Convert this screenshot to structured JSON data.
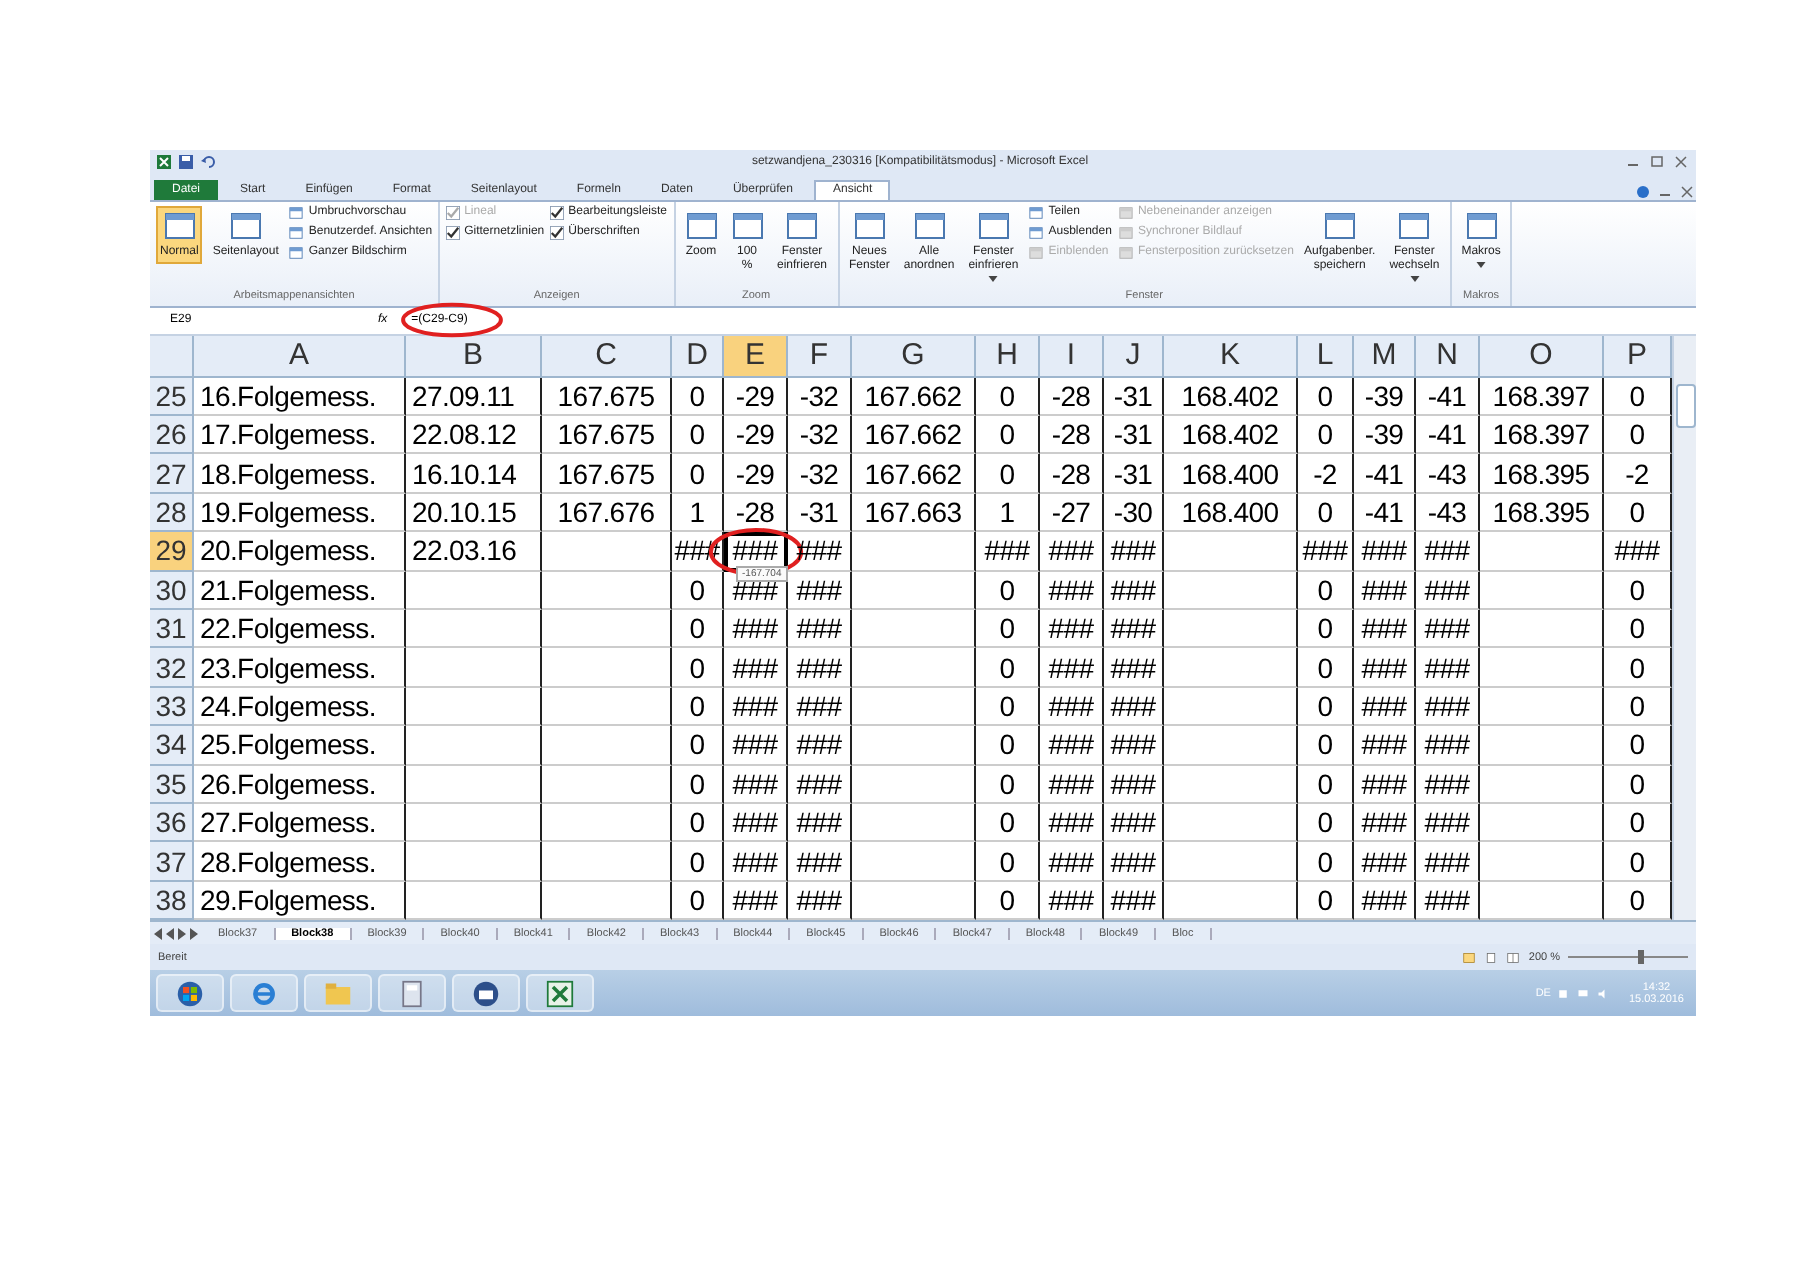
{
  "window": {
    "title": "setzwandjena_230316 [Kompatibilitätsmodus] - Microsoft Excel"
  },
  "tabs": [
    {
      "label": "Datei",
      "selected": false,
      "kind": "file"
    },
    {
      "label": "Start",
      "selected": false,
      "kind": "tab"
    },
    {
      "label": "Einfügen",
      "selected": false,
      "kind": "tab"
    },
    {
      "label": "Format",
      "selected": false,
      "kind": "tab"
    },
    {
      "label": "Seitenlayout",
      "selected": false,
      "kind": "tab"
    },
    {
      "label": "Formeln",
      "selected": false,
      "kind": "tab"
    },
    {
      "label": "Daten",
      "selected": false,
      "kind": "tab"
    },
    {
      "label": "Überprüfen",
      "selected": false,
      "kind": "tab"
    },
    {
      "label": "Ansicht",
      "selected": true,
      "kind": "tab"
    }
  ],
  "ribbon": [
    {
      "title": "Arbeitsmappenansichten",
      "items": [
        {
          "kind": "large",
          "label": "Normal",
          "selected": true
        },
        {
          "kind": "large",
          "label": "Seitenlayout",
          "selected": false
        },
        {
          "kind": "small",
          "label": "Umbruchvorschau",
          "disabled": false
        },
        {
          "kind": "small",
          "label": "Benutzerdef. Ansichten",
          "disabled": false
        },
        {
          "kind": "small",
          "label": "Ganzer Bildschirm",
          "disabled": false
        }
      ]
    },
    {
      "title": "Anzeigen",
      "items": [
        {
          "kind": "check",
          "label": "Lineal",
          "checked": true,
          "disabled": true
        },
        {
          "kind": "check",
          "label": "Gitternetzlinien",
          "checked": true,
          "disabled": false
        },
        {
          "kind": "check",
          "label": "Bearbeitungsleiste",
          "checked": true,
          "disabled": false
        },
        {
          "kind": "check",
          "label": "Überschriften",
          "checked": true,
          "disabled": false
        }
      ]
    },
    {
      "title": "Zoom",
      "items": [
        {
          "kind": "large",
          "label": "Zoom",
          "selected": false
        },
        {
          "kind": "large",
          "label": "100 %",
          "selected": false
        },
        {
          "kind": "large",
          "label": "Fenster einfrieren",
          "selected": false
        }
      ]
    },
    {
      "title": "Fenster",
      "items": [
        {
          "kind": "large",
          "label": "Neues Fenster",
          "selected": false
        },
        {
          "kind": "large",
          "label": "Alle anordnen",
          "selected": false
        },
        {
          "kind": "large",
          "label": "Fenster einfrieren",
          "selected": false,
          "dropdown": true
        },
        {
          "kind": "small",
          "label": "Teilen",
          "disabled": false
        },
        {
          "kind": "small",
          "label": "Ausblenden",
          "disabled": false
        },
        {
          "kind": "small",
          "label": "Einblenden",
          "disabled": true
        },
        {
          "kind": "small",
          "label": "Nebeneinander anzeigen",
          "disabled": true
        },
        {
          "kind": "small",
          "label": "Synchroner Bildlauf",
          "disabled": true
        },
        {
          "kind": "small",
          "label": "Fensterposition zurücksetzen",
          "disabled": true
        },
        {
          "kind": "large",
          "label": "Aufgabenber. speichern",
          "selected": false
        },
        {
          "kind": "large",
          "label": "Fenster wechseln",
          "selected": false,
          "dropdown": true
        }
      ]
    },
    {
      "title": "Makros",
      "items": [
        {
          "kind": "large",
          "label": "Makros",
          "selected": false,
          "dropdown": true
        }
      ]
    }
  ],
  "formula_bar": {
    "name_box": "E29",
    "fx": "fx",
    "formula": "=(C29-C9)",
    "circled": true
  },
  "table": {
    "columns": [
      {
        "label": "A",
        "selected": false
      },
      {
        "label": "B",
        "selected": false
      },
      {
        "label": "C",
        "selected": false
      },
      {
        "label": "D",
        "selected": false
      },
      {
        "label": "E",
        "selected": true
      },
      {
        "label": "F",
        "selected": false
      },
      {
        "label": "G",
        "selected": false
      },
      {
        "label": "H",
        "selected": false
      },
      {
        "label": "I",
        "selected": false
      },
      {
        "label": "J",
        "selected": false
      },
      {
        "label": "K",
        "selected": false
      },
      {
        "label": "L",
        "selected": false
      },
      {
        "label": "M",
        "selected": false
      },
      {
        "label": "N",
        "selected": false
      },
      {
        "label": "O",
        "selected": false
      },
      {
        "label": "P",
        "selected": false
      }
    ],
    "selected_cell": {
      "circled": true,
      "tooltip": "-167.704"
    },
    "rows": [
      {
        "header": "25",
        "selected": false,
        "cells": [
          "16.Folgemess.",
          "27.09.11",
          "167.675",
          "0",
          "-29",
          "-32",
          "167.662",
          "0",
          "-28",
          "-31",
          "168.402",
          "0",
          "-39",
          "-41",
          "168.397",
          "0"
        ]
      },
      {
        "header": "26",
        "selected": false,
        "cells": [
          "17.Folgemess.",
          "22.08.12",
          "167.675",
          "0",
          "-29",
          "-32",
          "167.662",
          "0",
          "-28",
          "-31",
          "168.402",
          "0",
          "-39",
          "-41",
          "168.397",
          "0"
        ]
      },
      {
        "header": "27",
        "selected": false,
        "cells": [
          "18.Folgemess.",
          "16.10.14",
          "167.675",
          "0",
          "-29",
          "-32",
          "167.662",
          "0",
          "-28",
          "-31",
          "168.400",
          "-2",
          "-41",
          "-43",
          "168.395",
          "-2"
        ]
      },
      {
        "header": "28",
        "selected": false,
        "cells": [
          "19.Folgemess.",
          "20.10.15",
          "167.676",
          "1",
          "-28",
          "-31",
          "167.663",
          "1",
          "-27",
          "-30",
          "168.400",
          "0",
          "-41",
          "-43",
          "168.395",
          "0"
        ]
      },
      {
        "header": "29",
        "selected": true,
        "cells": [
          "20.Folgemess.",
          "22.03.16",
          null,
          "###",
          "###",
          "###",
          null,
          "###",
          "###",
          "###",
          null,
          "###",
          "###",
          "###",
          null,
          "###"
        ]
      },
      {
        "header": "30",
        "selected": false,
        "cells": [
          "21.Folgemess.",
          null,
          null,
          "0",
          "###",
          "###",
          null,
          "0",
          "###",
          "###",
          null,
          "0",
          "###",
          "###",
          null,
          "0"
        ]
      },
      {
        "header": "31",
        "selected": false,
        "cells": [
          "22.Folgemess.",
          null,
          null,
          "0",
          "###",
          "###",
          null,
          "0",
          "###",
          "###",
          null,
          "0",
          "###",
          "###",
          null,
          "0"
        ]
      },
      {
        "header": "32",
        "selected": false,
        "cells": [
          "23.Folgemess.",
          null,
          null,
          "0",
          "###",
          "###",
          null,
          "0",
          "###",
          "###",
          null,
          "0",
          "###",
          "###",
          null,
          "0"
        ]
      },
      {
        "header": "33",
        "selected": false,
        "cells": [
          "24.Folgemess.",
          null,
          null,
          "0",
          "###",
          "###",
          null,
          "0",
          "###",
          "###",
          null,
          "0",
          "###",
          "###",
          null,
          "0"
        ]
      },
      {
        "header": "34",
        "selected": false,
        "cells": [
          "25.Folgemess.",
          null,
          null,
          "0",
          "###",
          "###",
          null,
          "0",
          "###",
          "###",
          null,
          "0",
          "###",
          "###",
          null,
          "0"
        ]
      },
      {
        "header": "35",
        "selected": false,
        "cells": [
          "26.Folgemess.",
          null,
          null,
          "0",
          "###",
          "###",
          null,
          "0",
          "###",
          "###",
          null,
          "0",
          "###",
          "###",
          null,
          "0"
        ]
      },
      {
        "header": "36",
        "selected": false,
        "cells": [
          "27.Folgemess.",
          null,
          null,
          "0",
          "###",
          "###",
          null,
          "0",
          "###",
          "###",
          null,
          "0",
          "###",
          "###",
          null,
          "0"
        ]
      },
      {
        "header": "37",
        "selected": false,
        "cells": [
          "28.Folgemess.",
          null,
          null,
          "0",
          "###",
          "###",
          null,
          "0",
          "###",
          "###",
          null,
          "0",
          "###",
          "###",
          null,
          "0"
        ]
      },
      {
        "header": "38",
        "selected": false,
        "cells": [
          "29.Folgemess.",
          null,
          null,
          "0",
          "###",
          "###",
          null,
          "0",
          "###",
          "###",
          null,
          "0",
          "###",
          "###",
          null,
          "0"
        ]
      }
    ]
  },
  "sheet_tabs": [
    {
      "label": "Block37",
      "selected": false
    },
    {
      "label": "Block38",
      "selected": true
    },
    {
      "label": "Block39",
      "selected": false
    },
    {
      "label": "Block40",
      "selected": false
    },
    {
      "label": "Block41",
      "selected": false
    },
    {
      "label": "Block42",
      "selected": false
    },
    {
      "label": "Block43",
      "selected": false
    },
    {
      "label": "Block44",
      "selected": false
    },
    {
      "label": "Block45",
      "selected": false
    },
    {
      "label": "Block46",
      "selected": false
    },
    {
      "label": "Block47",
      "selected": false
    },
    {
      "label": "Block48",
      "selected": false
    },
    {
      "label": "Block49",
      "selected": false
    },
    {
      "label": "Bloc",
      "selected": false
    }
  ],
  "status_bar": {
    "status": "Bereit",
    "zoom": "200 %",
    "zoom_slider": {
      "level": 0.6
    }
  },
  "taskbar": {
    "language": "DE",
    "time": "14:32",
    "date": "15.03.2016"
  }
}
